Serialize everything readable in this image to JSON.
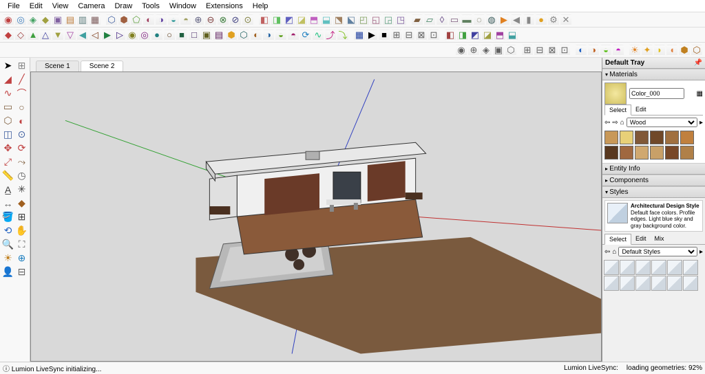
{
  "menu": [
    "File",
    "Edit",
    "View",
    "Camera",
    "Draw",
    "Tools",
    "Window",
    "Extensions",
    "Help"
  ],
  "tabs": [
    {
      "label": "Scene 1",
      "active": false
    },
    {
      "label": "Scene 2",
      "active": true
    }
  ],
  "tray": {
    "title": "Default Tray",
    "materials": {
      "header": "Materials",
      "name": "Color_000",
      "tabs": [
        "Select",
        "Edit"
      ],
      "category": "Wood",
      "swatches": [
        "#c89858",
        "#e8d078",
        "#805838",
        "#704828",
        "#a07040",
        "#c0803e",
        "#583820",
        "#a06840",
        "#d0a870",
        "#c8a068",
        "#784828",
        "#b08048"
      ]
    },
    "entity_info": "Entity Info",
    "components": "Components",
    "styles": {
      "header": "Styles",
      "name": "Architectural Design Style",
      "desc": "Default face colors. Profile edges. Light blue sky and gray background color.",
      "tabs": [
        "Select",
        "Edit",
        "Mix"
      ],
      "category": "Default Styles"
    }
  },
  "status": {
    "left": "Lumion LiveSync initializing...",
    "mid": "Lumion LiveSync:",
    "right": "loading geometries: 92%"
  }
}
